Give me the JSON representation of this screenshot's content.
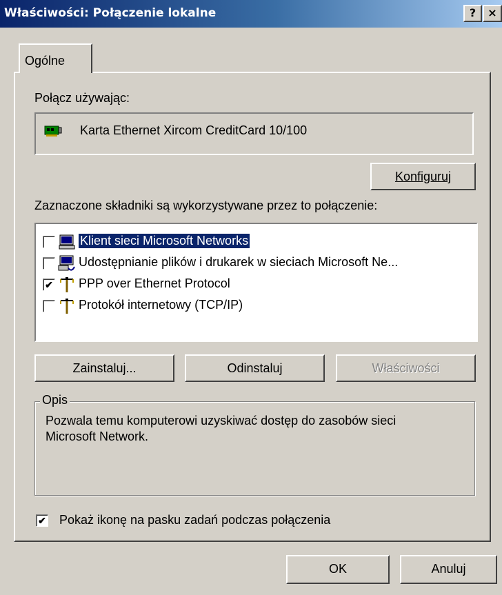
{
  "window": {
    "title": "Właściwości: Połączenie lokalne",
    "help_glyph": "?",
    "close_glyph": "×"
  },
  "tabs": [
    {
      "label": "Ogólne",
      "active": true
    }
  ],
  "connect_using": {
    "label": "Połącz używając:",
    "adapter_icon": "network-card-icon",
    "adapter": "Karta Ethernet Xircom CreditCard 10/100",
    "configure_button": "Konfiguruj"
  },
  "components": {
    "label": "Zaznaczone składniki są wykorzystywane przez to połączenie:",
    "items": [
      {
        "label": "Klient sieci Microsoft Networks",
        "checked": false,
        "selected": true,
        "icon": "network-client-icon"
      },
      {
        "label": "Udostępnianie plików i drukarek w sieciach Microsoft Ne...",
        "checked": false,
        "selected": false,
        "icon": "file-printer-sharing-icon"
      },
      {
        "label": "PPP over Ethernet Protocol",
        "checked": true,
        "selected": false,
        "icon": "protocol-icon"
      },
      {
        "label": "Protokół internetowy (TCP/IP)",
        "checked": false,
        "selected": false,
        "icon": "protocol-icon"
      }
    ],
    "check_glyph": "✔",
    "install_button": "Zainstaluj...",
    "uninstall_button": "Odinstaluj",
    "properties_button": "Właściwości",
    "properties_disabled": true
  },
  "description": {
    "legend": "Opis",
    "line1": "Pozwala temu komputerowi uzyskiwać dostęp do zasobów sieci",
    "line2": "Microsoft Network."
  },
  "show_icon": {
    "checked": true,
    "label": "Pokaż ikonę na pasku zadań podczas połączenia"
  },
  "footer": {
    "ok_button": "OK",
    "cancel_button": "Anuluj"
  },
  "colors": {
    "title_start": "#0a246a",
    "title_end": "#a6caf0",
    "face": "#d4d0c8",
    "selection": "#0a246a"
  }
}
